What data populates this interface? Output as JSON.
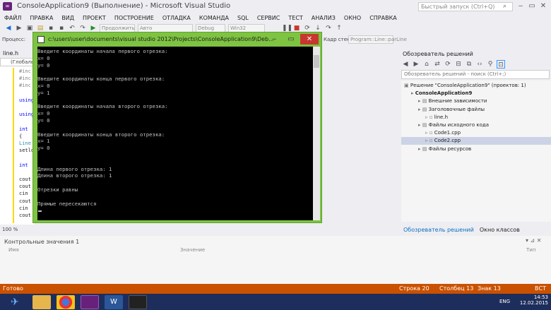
{
  "window": {
    "title": "ConsoleApplication9 (Выполнение) - Microsoft Visual Studio",
    "quick_launch_placeholder": "Быстрый запуск (Ctrl+Q)"
  },
  "menu": [
    "ФАЙЛ",
    "ПРАВКА",
    "ВИД",
    "ПРОЕКТ",
    "ПОСТРОЕНИЕ",
    "ОТЛАДКА",
    "КОМАНДА",
    "SQL",
    "СЕРВИС",
    "ТЕСТ",
    "АНАЛИЗ",
    "ОКНО",
    "СПРАВКА"
  ],
  "toolbar": {
    "continue_label": "Продолжить",
    "auto_combo": "Авто",
    "config_combo": "Debug",
    "platform_combo": "Win32",
    "process_label": "Процесс:",
    "stack_label": "Кадр стека:",
    "stack_value": "Program::Line::parLine"
  },
  "editor": {
    "tab": "line.h",
    "scope": "(Глобаль",
    "lines": [
      "#inc",
      "#inc",
      "#inc",
      "",
      "using",
      "",
      "using",
      "",
      "int",
      "{",
      "Line",
      "setlo",
      "",
      "int",
      "",
      "cout",
      "cout",
      "cin",
      "cout",
      "cin",
      "cout"
    ],
    "zoom": "100 %"
  },
  "console": {
    "title": "c:\\users\\user\\documents\\visual studio 2012\\Projects\\ConsoleApplication9\\Deb...",
    "lines": [
      "Введите координаты начала первого отрезка:",
      "x= 0",
      "y= 0",
      "",
      "Введите координаты конца первого отрезка:",
      "x= 0",
      "y= 1",
      "",
      "Введите координаты начала второго отрезка:",
      "x= 0",
      "y= 0",
      "",
      "Введите координаты конца второго отрезка:",
      "x= 1",
      "y= 0",
      "",
      "",
      "Длина первого отрезка: 1",
      "Длина второго отрезка: 1",
      "",
      "Отрезки равны",
      "",
      "Прямые пересекаются"
    ]
  },
  "solution": {
    "header": "Обозреватель решений",
    "search_placeholder": "Обозреватель решений - поиск (Ctrl+;)",
    "items": [
      {
        "label": "Решение \"ConsoleApplication9\" (проектов: 1)",
        "indent": 0,
        "bold": false,
        "selected": false
      },
      {
        "label": "ConsoleApplication9",
        "indent": 1,
        "bold": true,
        "selected": false
      },
      {
        "label": "Внешние зависимости",
        "indent": 2,
        "bold": false,
        "selected": false
      },
      {
        "label": "Заголовочные файлы",
        "indent": 2,
        "bold": false,
        "selected": false
      },
      {
        "label": "line.h",
        "indent": 3,
        "bold": false,
        "selected": false
      },
      {
        "label": "Файлы исходного кода",
        "indent": 2,
        "bold": false,
        "selected": false
      },
      {
        "label": "Code1.cpp",
        "indent": 3,
        "bold": false,
        "selected": false
      },
      {
        "label": "Code2.cpp",
        "indent": 3,
        "bold": false,
        "selected": true
      },
      {
        "label": "Файлы ресурсов",
        "indent": 2,
        "bold": false,
        "selected": false
      }
    ],
    "tabs": [
      "Обозреватель решений",
      "Окно классов"
    ]
  },
  "watch": {
    "title": "Контрольные значения 1",
    "col_name": "Имя",
    "col_value": "Значение",
    "col_type": "Тип"
  },
  "status": {
    "ready": "Готово",
    "line": "Строка 20",
    "col": "Столбец 13",
    "char": "Знак 13",
    "mode": "ВСТ"
  },
  "taskbar": {
    "lang": "ENG",
    "time": "14:53",
    "date": "12.02.2015"
  },
  "colors": {
    "status_bar": "#ca5100",
    "console_frame": "#7ec342",
    "taskbar": "#1e2e5c"
  }
}
